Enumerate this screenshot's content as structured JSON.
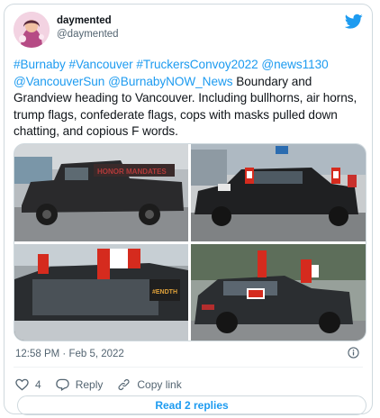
{
  "colors": {
    "link": "#1d9bf0",
    "text": "#0f1419",
    "muted": "#536471",
    "border": "#cfd9de"
  },
  "author": {
    "display_name": "daymented",
    "handle": "@daymented",
    "avatar_icon": "user-avatar",
    "brand_icon": "twitter-bird-icon"
  },
  "tweet": {
    "segments": [
      {
        "text": "#Burnaby",
        "link": true
      },
      {
        "text": " ",
        "link": false
      },
      {
        "text": "#Vancouver",
        "link": true
      },
      {
        "text": " ",
        "link": false
      },
      {
        "text": "#TruckersConvoy2022",
        "link": true
      },
      {
        "text": " ",
        "link": false
      },
      {
        "text": "@news1130",
        "link": true
      },
      {
        "text": " ",
        "link": false
      },
      {
        "text": "@VancouverSun",
        "link": true
      },
      {
        "text": " ",
        "link": false
      },
      {
        "text": "@BurnabyNOW_News",
        "link": true
      },
      {
        "text": " Boundary and Grandview heading to Vancouver. Including bullhorns, air horns, trump flags, confederate flags, cops with masks pulled down chatting, and copious F words.",
        "link": false
      }
    ]
  },
  "media": {
    "count": 4,
    "photos": [
      {
        "name": "photo-black-pickup-truck"
      },
      {
        "name": "photo-black-sedan-flags"
      },
      {
        "name": "photo-car-window-flags"
      },
      {
        "name": "photo-dark-suv-flags"
      }
    ]
  },
  "timestamp": "12:58 PM · Feb 5, 2022",
  "actions": {
    "like_count": "4",
    "reply_label": "Reply",
    "copy_link_label": "Copy link"
  },
  "read_replies_label": "Read 2 replies"
}
